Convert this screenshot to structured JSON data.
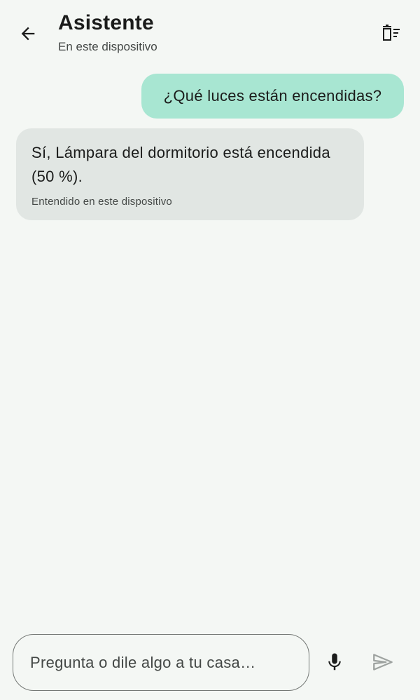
{
  "header": {
    "title": "Asistente",
    "subtitle": "En este dispositivo",
    "back_icon": "arrow-back-icon",
    "clear_icon": "clear-history-icon"
  },
  "conversation": {
    "messages": [
      {
        "role": "user",
        "text": "¿Qué luces están encendidas?"
      },
      {
        "role": "assistant",
        "text": "Sí, Lámpara del dormitorio está encendida (50 %).",
        "meta": "Entendido en este dispositivo"
      }
    ]
  },
  "composer": {
    "placeholder": "Pregunta o dile algo a tu casa…",
    "value": "",
    "mic_icon": "microphone-icon",
    "send_icon": "send-icon"
  },
  "colors": {
    "background": "#f4f7f4",
    "user_bubble": "#a8e6d2",
    "assistant_bubble": "#e1e6e3",
    "send_disabled": "#9ea3a0"
  }
}
